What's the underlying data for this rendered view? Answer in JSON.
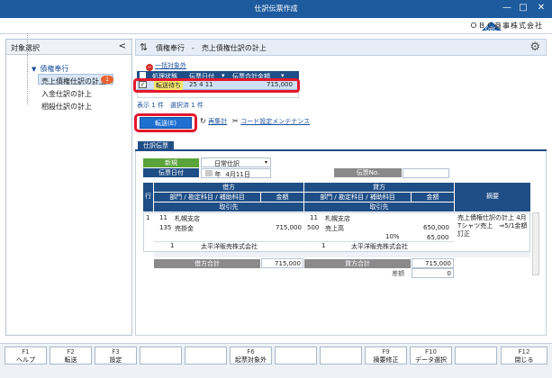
{
  "window": {
    "title": "仕訳伝票作成",
    "company": "ＯＢＣ商事株式会社",
    "minimize": "—",
    "maximize": "□",
    "close": "✕",
    "logo_text": "OBC"
  },
  "left_panel": {
    "header": "対象選択",
    "collapse": "<",
    "root": "債権奉行",
    "items": [
      {
        "label": "売上債権仕訳の計上",
        "badge": "1"
      },
      {
        "label": "入金仕訳の計上"
      },
      {
        "label": "相殺仕訳の計上"
      }
    ]
  },
  "main_header": {
    "title": "債権奉行　‐　売上債権仕訳の計上"
  },
  "exclusion": {
    "label": "一括対象外",
    "icon": "−"
  },
  "grid": {
    "columns": [
      "処理状態",
      "伝票日付",
      "伝票合計金額"
    ],
    "sort_marks": [
      "▾",
      "▾"
    ],
    "rows": [
      {
        "checked": "✓",
        "status": "転送待ち",
        "date": "25 4 11",
        "amount": "715,000"
      }
    ]
  },
  "counts": {
    "text": "表示 1 件　選択済 1 件"
  },
  "actions": {
    "send": "転送(E)",
    "recalc": "再集計",
    "codeset": "コード設定メンテナンス"
  },
  "tabs": {
    "journal": "仕訳伝票"
  },
  "form": {
    "mode": "新規",
    "type": "日常仕訳",
    "date_label": "伝票日付",
    "date_era": "年",
    "date_value": "4月11日",
    "voucher_no_label": "伝票No.",
    "debit_label": "借方",
    "credit_label": "貸方",
    "row_label": "行",
    "dept_acct": "部門 / 勘定科目 / 補助科目",
    "amount_label": "金額",
    "partner_label": "取引先",
    "memo_label": "摘要",
    "line": {
      "no": "1",
      "dr_dept_code": "11",
      "dr_dept_name": "札幌支店",
      "dr_acct_code": "135",
      "dr_acct_name": "売掛金",
      "dr_amount": "715,000",
      "dr_partner_code": "1",
      "dr_partner_name": "太平洋販売株式会社",
      "cr_dept_code": "11",
      "cr_dept_name": "札幌支店",
      "cr_acct_code": "500",
      "cr_acct_name": "売上高",
      "cr_amount": "650,000",
      "cr_tax_rate": "10%",
      "cr_tax": "65,000",
      "cr_partner_code": "1",
      "cr_partner_name": "太平洋販売株式会社",
      "memo": "売上債権仕訳の計上 4月Tシャツ売上　⇒5/1金額訂正"
    },
    "debit_total_label": "借方合計",
    "debit_total": "715,000",
    "credit_total_label": "貸方合計",
    "credit_total": "715,000",
    "diff_label": "差額",
    "diff": "0"
  },
  "fkeys": [
    {
      "key": "F1",
      "label": "ヘルプ"
    },
    {
      "key": "F2",
      "label": "転送"
    },
    {
      "key": "F3",
      "label": "設定"
    },
    {
      "key": "",
      "label": ""
    },
    {
      "key": "",
      "label": ""
    },
    {
      "key": "F6",
      "label": "起票対象外"
    },
    {
      "key": "",
      "label": ""
    },
    {
      "key": "",
      "label": ""
    },
    {
      "key": "F9",
      "label": "摘要修正"
    },
    {
      "key": "F10",
      "label": "データ選択"
    },
    {
      "key": "",
      "label": ""
    },
    {
      "key": "F12",
      "label": "閉じる"
    }
  ]
}
